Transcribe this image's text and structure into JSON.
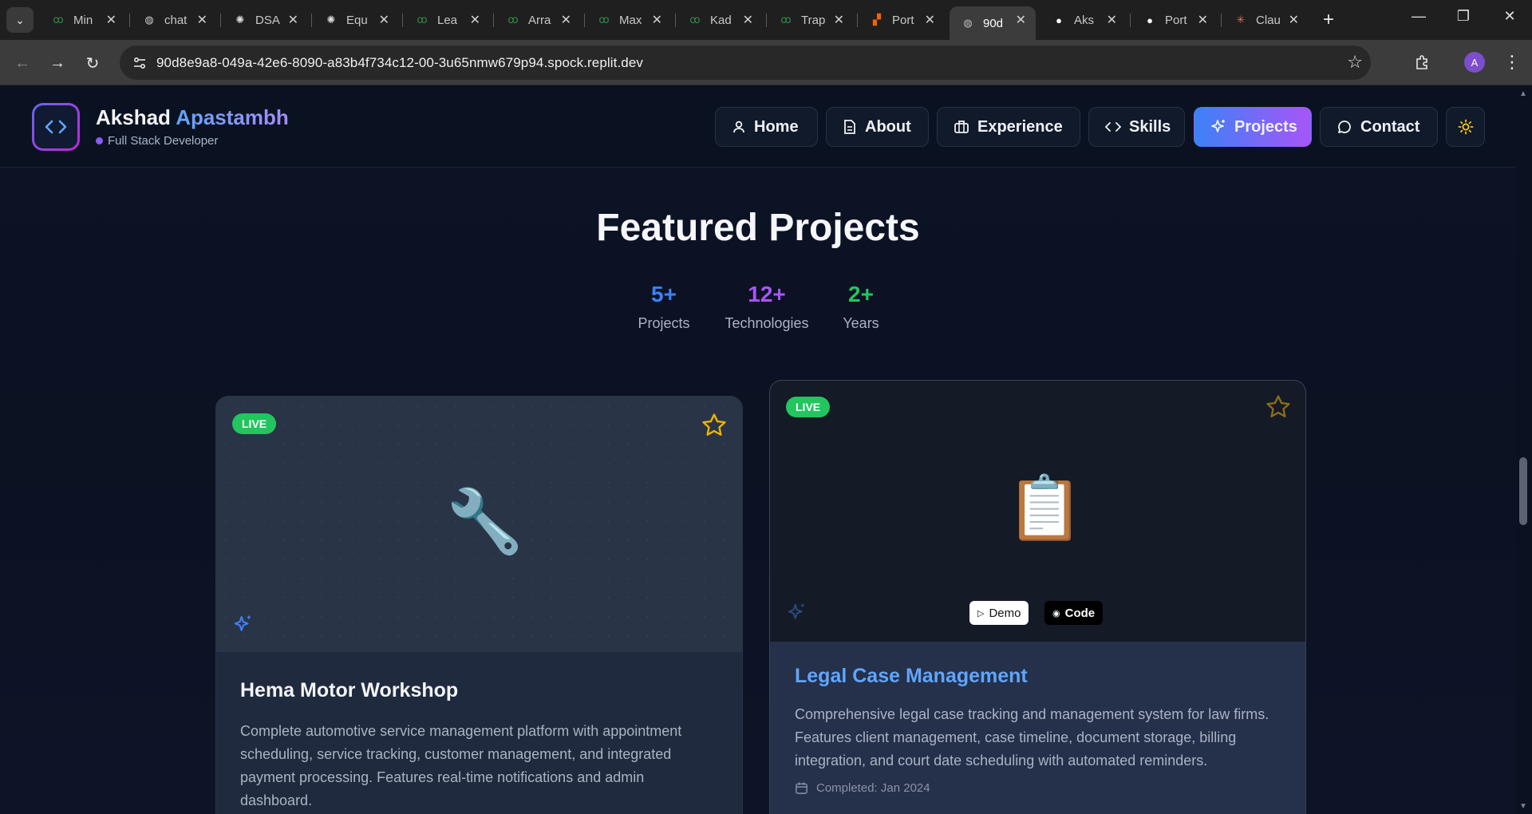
{
  "browser": {
    "tabs": [
      {
        "title": "Min",
        "icon": "gfg-icon",
        "active": false
      },
      {
        "title": "chat",
        "icon": "globe-icon",
        "active": false
      },
      {
        "title": "DSA",
        "icon": "openai-icon",
        "active": false
      },
      {
        "title": "Equ",
        "icon": "openai-icon",
        "active": false
      },
      {
        "title": "Lea",
        "icon": "gfg-icon",
        "active": false
      },
      {
        "title": "Arra",
        "icon": "gfg-icon",
        "active": false
      },
      {
        "title": "Max",
        "icon": "gfg-icon",
        "active": false
      },
      {
        "title": "Kad",
        "icon": "gfg-icon",
        "active": false
      },
      {
        "title": "Trap",
        "icon": "gfg-icon",
        "active": false
      },
      {
        "title": "Port",
        "icon": "replit-icon",
        "active": false
      },
      {
        "title": "90d",
        "icon": "globe-icon",
        "active": true
      },
      {
        "title": "Aks",
        "icon": "github-icon",
        "active": false
      },
      {
        "title": "Port",
        "icon": "github-icon",
        "active": false
      },
      {
        "title": "Clau",
        "icon": "claude-icon",
        "active": false
      }
    ],
    "url": "90d8e9a8-049a-42e6-8090-a83b4f734c12-00-3u65nmw679p94.spock.replit.dev",
    "profile_initial": "A"
  },
  "site": {
    "brand_first": "Akshad",
    "brand_second": "Apastambh",
    "role": "Full Stack Developer",
    "nav": [
      {
        "label": "Home",
        "icon": "user-icon"
      },
      {
        "label": "About",
        "icon": "document-icon"
      },
      {
        "label": "Experience",
        "icon": "briefcase-icon"
      },
      {
        "label": "Skills",
        "icon": "code-icon"
      },
      {
        "label": "Projects",
        "icon": "sparkles-icon",
        "active": true
      },
      {
        "label": "Contact",
        "icon": "chat-bubble-icon"
      }
    ]
  },
  "projects": {
    "title": "Featured Projects",
    "stats": [
      {
        "value": "5+",
        "label": "Projects",
        "color": "#3b82f6"
      },
      {
        "value": "12+",
        "label": "Technologies",
        "color": "#a855f7"
      },
      {
        "value": "2+",
        "label": "Years",
        "color": "#22c55e"
      }
    ],
    "cards": [
      {
        "badge": "LIVE",
        "emoji": "🔧",
        "title": "Hema Motor Workshop",
        "description": "Complete automotive service management platform with appointment scheduling, service tracking, customer management, and integrated payment processing. Features real-time notifications and admin dashboard."
      },
      {
        "badge": "LIVE",
        "emoji": "📋",
        "demo_label": "Demo",
        "code_label": "Code",
        "title": "Legal Case Management",
        "description": "Comprehensive legal case tracking and management system for law firms. Features client management, case timeline, document storage, billing integration, and court date scheduling with automated reminders.",
        "completed": "Completed: Jan 2024"
      }
    ]
  },
  "colors": {
    "accent_blue": "#3b82f6",
    "accent_purple": "#a855f7",
    "live_green": "#22c55e",
    "star_gold": "#eab308",
    "title_blue": "#60a5fa"
  }
}
